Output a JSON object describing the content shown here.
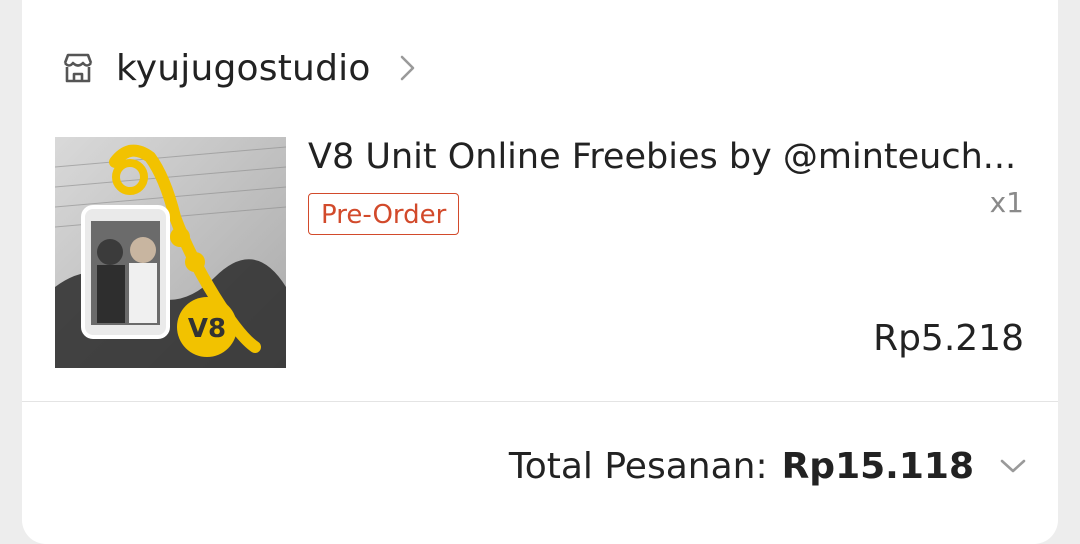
{
  "shop": {
    "name": "kyujugostudio",
    "icon": "store-icon",
    "chevron_icon": "chevron-right-icon"
  },
  "product": {
    "title": "V8 Unit Online Freebies by @minteuch...",
    "badge": "Pre-Order",
    "quantity": "x1",
    "price": "Rp5.218",
    "thumbnail_text": "V8",
    "colors": {
      "badge": "#d24a2b",
      "keyring": "#f2c200"
    }
  },
  "summary": {
    "label": "Total Pesanan:",
    "value": "Rp15.118",
    "chevron_icon": "chevron-down-icon"
  }
}
